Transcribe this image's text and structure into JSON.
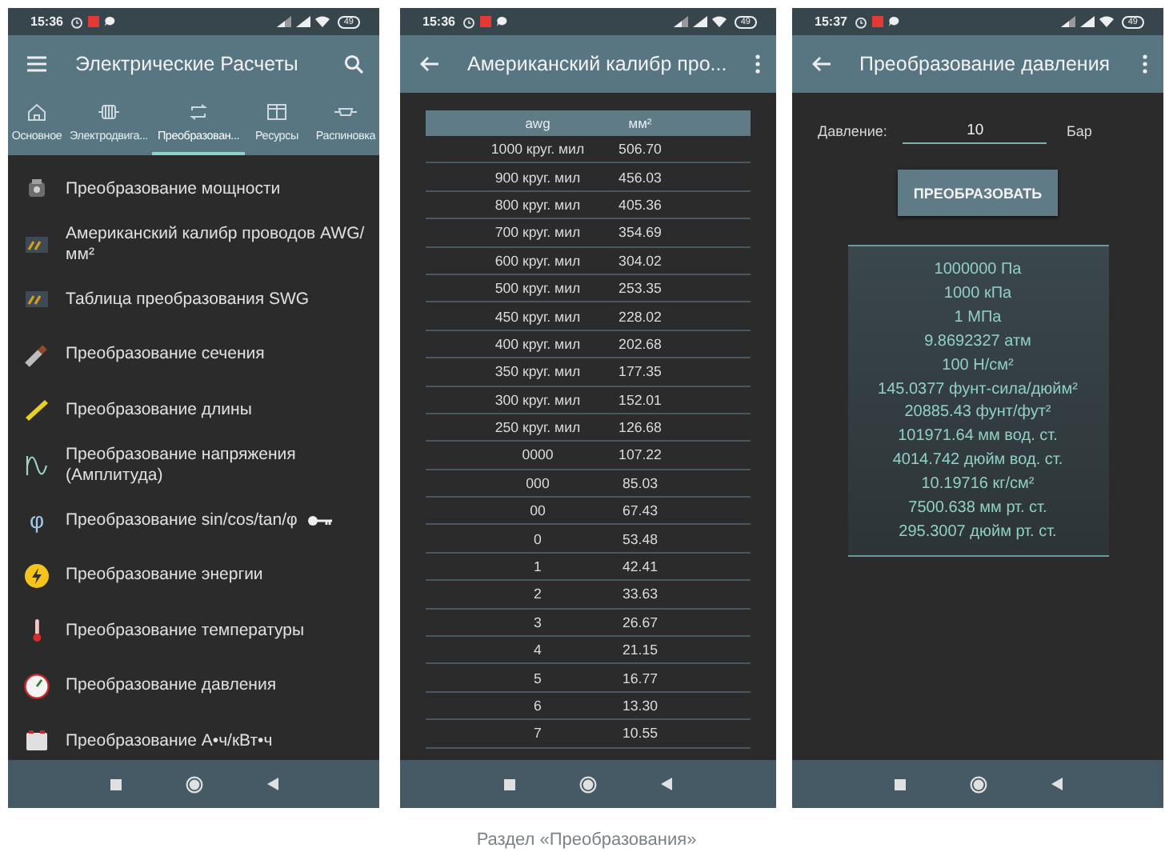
{
  "screen_menu": {
    "status_bar": {
      "time": "15:36",
      "battery": "49"
    },
    "app_bar": {
      "title": "Электрические Расчеты"
    },
    "tabs": [
      {
        "label": "Основное",
        "selected": false
      },
      {
        "label": "Электродвига...",
        "selected": false
      },
      {
        "label": "Преобразован...",
        "selected": true
      },
      {
        "label": "Ресурсы",
        "selected": false
      },
      {
        "label": "Распиновка",
        "selected": false
      }
    ],
    "items": [
      {
        "label": "Преобразование мощности",
        "locked": false
      },
      {
        "label": "Американский калибр проводов AWG/мм²",
        "locked": false
      },
      {
        "label": "Таблица преобразования SWG",
        "locked": false
      },
      {
        "label": "Преобразование сечения",
        "locked": false
      },
      {
        "label": "Преобразование длины",
        "locked": false
      },
      {
        "label": "Преобразование напряжения (Амплитуда)",
        "locked": false
      },
      {
        "label": "Преобразование sin/cos/tan/φ",
        "glyph": "φ",
        "locked": true
      },
      {
        "label": "Преобразование энергии",
        "locked": false
      },
      {
        "label": "Преобразование температуры",
        "locked": false
      },
      {
        "label": "Преобразование давления",
        "locked": false
      },
      {
        "label": "Преобразование А•ч/кВт•ч",
        "locked": false
      }
    ]
  },
  "screen_table": {
    "status_bar": {
      "time": "15:36",
      "battery": "49"
    },
    "app_bar": {
      "title": "Американский калибр про..."
    },
    "table": {
      "columns": [
        "awg",
        "мм²"
      ],
      "rows": [
        [
          "1000 круг. мил",
          "506.70"
        ],
        [
          "900 круг. мил",
          "456.03"
        ],
        [
          "800 круг. мил",
          "405.36"
        ],
        [
          "700 круг. мил",
          "354.69"
        ],
        [
          "600 круг. мил",
          "304.02"
        ],
        [
          "500 круг. мил",
          "253.35"
        ],
        [
          "450 круг. мил",
          "228.02"
        ],
        [
          "400 круг. мил",
          "202.68"
        ],
        [
          "350 круг. мил",
          "177.35"
        ],
        [
          "300 круг. мил",
          "152.01"
        ],
        [
          "250 круг. мил",
          "126.68"
        ],
        [
          "0000",
          "107.22"
        ],
        [
          "000",
          "85.03"
        ],
        [
          "00",
          "67.43"
        ],
        [
          "0",
          "53.48"
        ],
        [
          "1",
          "42.41"
        ],
        [
          "2",
          "33.63"
        ],
        [
          "3",
          "26.67"
        ],
        [
          "4",
          "21.15"
        ],
        [
          "5",
          "16.77"
        ],
        [
          "6",
          "13.30"
        ],
        [
          "7",
          "10.55"
        ]
      ]
    }
  },
  "screen_pressure": {
    "status_bar": {
      "time": "15:37",
      "battery": "49"
    },
    "app_bar": {
      "title": "Преобразование давления"
    },
    "input": {
      "label": "Давление:",
      "value": "10",
      "unit": "Бар"
    },
    "button": "ПРЕОБРАЗОВАТЬ",
    "results": [
      "1000000 Па",
      "1000 кПа",
      "1 МПа",
      "9.8692327 атм",
      "100 Н/см²",
      "145.0377 фунт-сила/дюйм²",
      "20885.43 фунт/фут²",
      "101971.64 мм вод. ст.",
      "4014.742 дюйм вод. ст.",
      "10.19716 кг/см²",
      "7500.638 мм рт. ст.",
      "295.3007 дюйм рт. ст."
    ]
  },
  "caption": "Раздел «Преобразования»"
}
